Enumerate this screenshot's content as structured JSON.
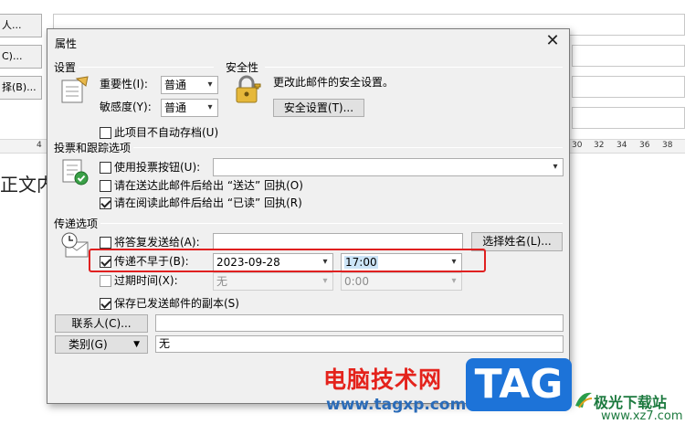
{
  "background": {
    "buttons": [
      "人...",
      "C)...",
      "择(B)..."
    ],
    "ruler_ticks": [
      "4",
      "30",
      "32",
      "34",
      "36",
      "38"
    ],
    "body_text": "正文内"
  },
  "dialog": {
    "title": "属性",
    "close_glyph": "✕",
    "settings": {
      "group_title": "设置",
      "importance_label": "重要性(I):",
      "importance_value": "普通",
      "sensitivity_label": "敏感度(Y):",
      "sensitivity_value": "普通",
      "no_autoarchive_label": "此项目不自动存档(U)"
    },
    "security": {
      "group_title": "安全性",
      "description": "更改此邮件的安全设置。",
      "button_label": "安全设置(T)..."
    },
    "voting": {
      "group_title": "投票和跟踪选项",
      "use_voting_label": "使用投票按钮(U):",
      "voting_value": "",
      "delivery_receipt_label": "请在送达此邮件后给出 “送达” 回执(O)",
      "read_receipt_label": "请在阅读此邮件后给出 “已读” 回执(R)"
    },
    "delivery": {
      "group_title": "传递选项",
      "replies_to_label": "将答复发送给(A):",
      "replies_to_value": "",
      "select_names_label": "选择姓名(L)...",
      "no_earlier_label": "传递不早于(B):",
      "no_earlier_date": "2023-09-28",
      "no_earlier_time": "17:00",
      "expires_label": "过期时间(X):",
      "expires_date": "无",
      "expires_time": "0:00",
      "save_copy_label": "保存已发送邮件的副本(S)"
    },
    "contacts_button_label": "联系人(C)...",
    "contacts_value": "",
    "categories_button_label": "类别(G)",
    "categories_value": "无"
  },
  "watermark": {
    "site_text": "电脑技术网",
    "site_url": "www.tagxp.com",
    "tag_logo": "TAG",
    "brand_text": "极光下载站",
    "brand_url": "www.xz7.com"
  },
  "colors": {
    "highlight_box": "#e02020",
    "dialog_bg": "#f0f0f0",
    "selection": "#cce4f7"
  }
}
